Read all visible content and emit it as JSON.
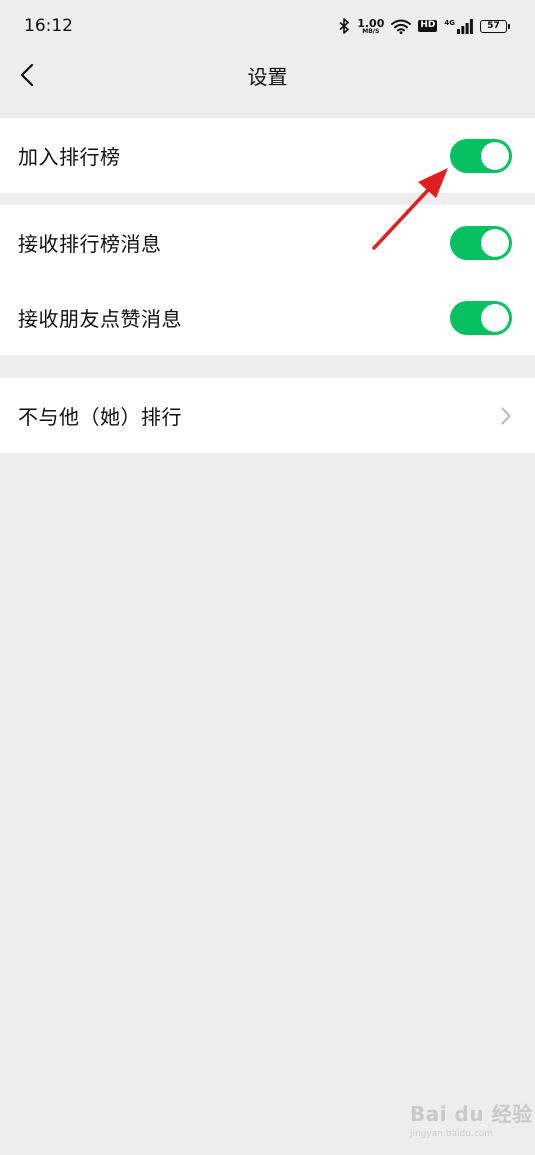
{
  "status_bar": {
    "time": "16:12",
    "net_speed_value": "1.00",
    "net_speed_unit": "MB/S",
    "hd_label": "HD",
    "signal_label": "4G",
    "battery_level": "57",
    "icons": [
      "bluetooth-icon",
      "wifi-icon",
      "signal-icon",
      "battery-icon"
    ]
  },
  "nav": {
    "title": "设置",
    "back_icon": "chevron-left-icon"
  },
  "settings": {
    "join_ranking": {
      "label": "加入排行榜",
      "enabled": true
    },
    "ranking_messages": {
      "label": "接收排行榜消息",
      "enabled": true
    },
    "like_messages": {
      "label": "接收朋友点赞消息",
      "enabled": true
    },
    "exclude_ranking": {
      "label": "不与他（她）排行"
    }
  },
  "colors": {
    "toggle_on": "#07c160",
    "background": "#ededed",
    "annotation_arrow": "#e02020"
  },
  "watermark": {
    "main": "Bai du 经验",
    "sub": "jingyan.baidu.com"
  }
}
